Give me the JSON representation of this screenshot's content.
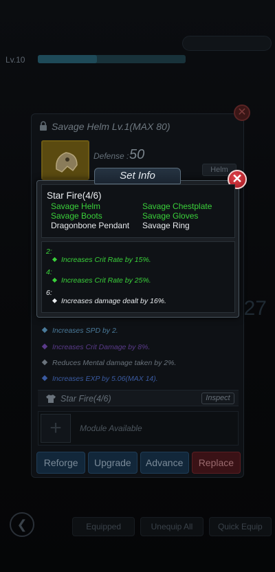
{
  "background": {
    "level_label": "Lv.10",
    "side_number": "27",
    "tabs": [
      "Equipped",
      "Unequip All",
      "Quick Equip"
    ]
  },
  "item_panel": {
    "title": "Savage Helm Lv.1(MAX 80)",
    "defense_label": "Defense :",
    "defense_value": "50",
    "slot_tag": "Helm",
    "sub_stats": [
      {
        "text": "Increases SPD by 2.",
        "color": "#4a7a9a"
      },
      {
        "text": "Increases Crit Damage by 8%.",
        "color": "#5a3a8a"
      },
      {
        "text": "Reduces Mental damage taken by 2%.",
        "color": "#6a737c"
      },
      {
        "text": "Increases EXP by 5.06(MAX 14).",
        "color": "#3a5aa0"
      }
    ],
    "set_row_label": "Star Fire(4/6)",
    "inspect_label": "Inspect",
    "module_label": "Module Available",
    "actions": {
      "reforge": "Reforge",
      "upgrade": "Upgrade",
      "advance": "Advance",
      "replace": "Replace"
    }
  },
  "set_info": {
    "header": "Set Info",
    "set_name": "Star Fire(4/6)",
    "pieces": [
      {
        "name": "Savage Helm",
        "owned": true
      },
      {
        "name": "Savage Chestplate",
        "owned": true
      },
      {
        "name": "Savage Boots",
        "owned": true
      },
      {
        "name": "Savage Gloves",
        "owned": true
      },
      {
        "name": "Dragonbone Pendant",
        "owned": false
      },
      {
        "name": "Savage Ring",
        "owned": false
      }
    ],
    "bonuses": [
      {
        "count": "2:",
        "text": "Increases Crit Rate by 15%.",
        "active": true
      },
      {
        "count": "4:",
        "text": "Increases Crit Rate by 25%.",
        "active": true
      },
      {
        "count": "6:",
        "text": "Increases damage dealt by 16%.",
        "active": false
      }
    ]
  },
  "colors": {
    "active_green": "#3ad13a",
    "close_red": "#c9252e"
  }
}
